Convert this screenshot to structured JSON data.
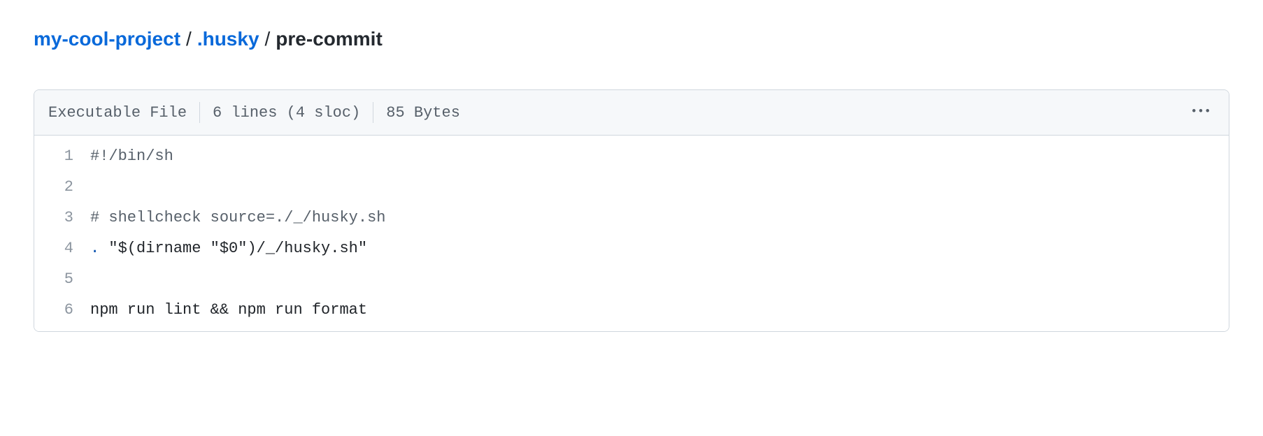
{
  "breadcrumb": {
    "root": "my-cool-project",
    "folder": ".husky",
    "file": "pre-commit",
    "separator": "/"
  },
  "file_header": {
    "executable": "Executable File",
    "lines": "6 lines (4 sloc)",
    "size": "85 Bytes"
  },
  "code": {
    "line1_num": "1",
    "line1": "#!/bin/sh",
    "line2_num": "2",
    "line2": "",
    "line3_num": "3",
    "line3_comment": "# shellcheck source=./_/husky.sh",
    "line4_num": "4",
    "line4_dot": ".",
    "line4_rest": " \"$(dirname \"$0\")/_/husky.sh\"",
    "line5_num": "5",
    "line5": "",
    "line6_num": "6",
    "line6": "npm run lint && npm run format"
  }
}
